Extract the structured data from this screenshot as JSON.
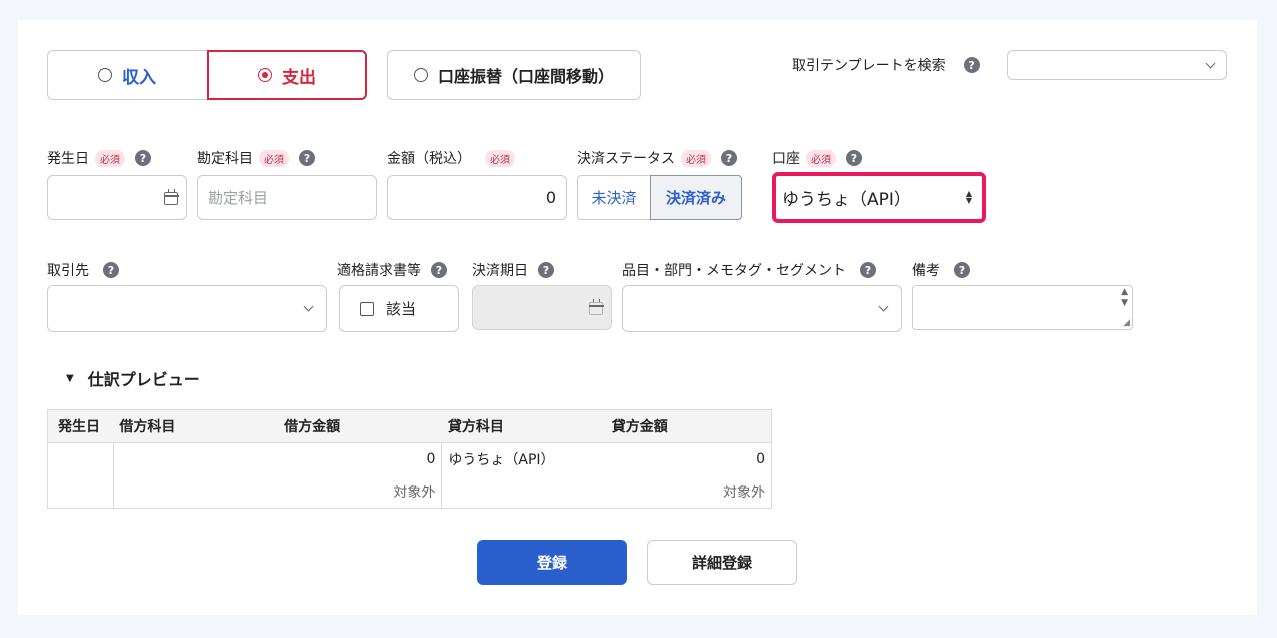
{
  "type_selector": {
    "income_label": "収入",
    "expense_label": "支出",
    "transfer_label": "口座振替（口座間移動）",
    "selected": "expense"
  },
  "template_search": {
    "label": "取引テンプレートを検索",
    "value": ""
  },
  "help_symbol": "?",
  "required_badge": "必須",
  "fields": {
    "date": {
      "label": "発生日",
      "value": ""
    },
    "account_item": {
      "label": "勘定科目",
      "placeholder": "勘定科目"
    },
    "amount": {
      "label": "金額（税込）",
      "value": "0"
    },
    "settlement": {
      "label": "決済ステータス",
      "options": [
        "未決済",
        "決済済み"
      ],
      "selected": "決済済み"
    },
    "wallet": {
      "label": "口座",
      "value": "ゆうちょ（API）"
    },
    "partner": {
      "label": "取引先",
      "value": ""
    },
    "invoice": {
      "label": "適格請求書等",
      "checkbox_label": "該当",
      "checked": false
    },
    "due_date": {
      "label": "決済期日",
      "value": ""
    },
    "tags": {
      "label": "品目・部門・メモタグ・セグメント",
      "value": ""
    },
    "note": {
      "label": "備考",
      "value": ""
    }
  },
  "preview": {
    "title": "仕訳プレビュー",
    "headers": [
      "発生日",
      "借方科目",
      "借方金額",
      "貸方科目",
      "貸方金額"
    ],
    "row": {
      "date": "",
      "debit_account": "",
      "debit_amount": "0",
      "debit_tax": "対象外",
      "credit_account": "ゆうちょ（API）",
      "credit_amount": "0",
      "credit_tax": "対象外"
    }
  },
  "actions": {
    "register": "登録",
    "detail_register": "詳細登録"
  },
  "colors": {
    "income_blue": "#2b5fce",
    "expense_red": "#d6263e",
    "highlight_pink": "#e8195f"
  }
}
